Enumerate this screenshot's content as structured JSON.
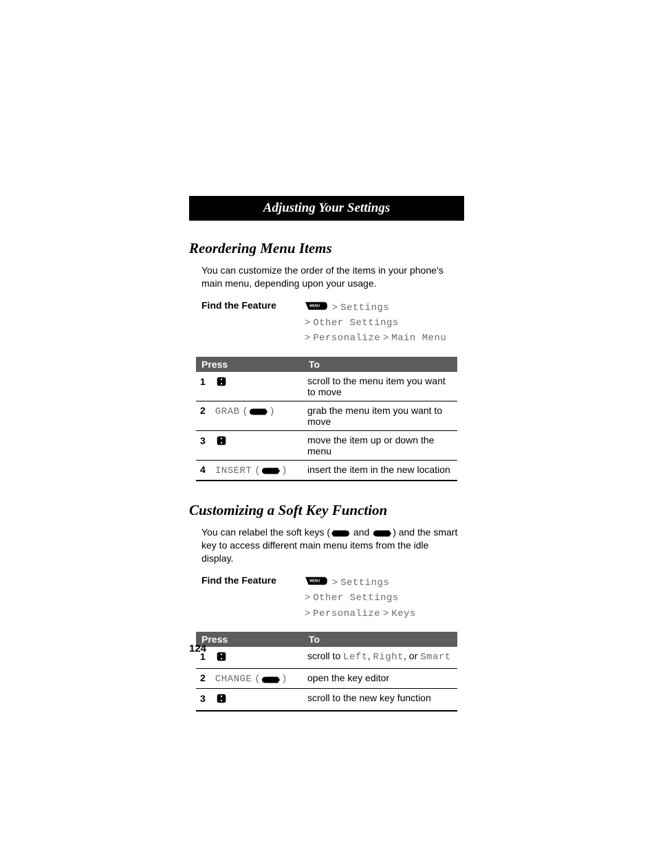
{
  "chapter": "Adjusting Your Settings",
  "section1": {
    "title": "Reordering Menu Items",
    "intro": "You can customize the order of the items in your phone’s main menu, depending upon your usage.",
    "find_feature_label": "Find the Feature",
    "path": {
      "line1_a": "Settings",
      "line2_a": "Other Settings",
      "line3_a": "Personalize",
      "line3_b": "Main Menu"
    },
    "table": {
      "head_press": "Press",
      "head_to": "To",
      "rows": [
        {
          "n": "1",
          "press": "scroll",
          "to": "scroll to the menu item you want to move"
        },
        {
          "n": "2",
          "press": "GRAB",
          "to": "grab the menu item you want to move"
        },
        {
          "n": "3",
          "press": "scroll",
          "to": "move the item up or down the menu"
        },
        {
          "n": "4",
          "press": "INSERT",
          "to": "insert the item in the new location"
        }
      ]
    }
  },
  "section2": {
    "title": "Customizing a Soft Key Function",
    "intro_a": "You can relabel the soft keys (",
    "intro_b": " and ",
    "intro_c": ") and the smart key to access different main menu items from the idle display.",
    "find_feature_label": "Find the Feature",
    "path": {
      "line1_a": "Settings",
      "line2_a": "Other Settings",
      "line3_a": "Personalize",
      "line3_b": "Keys"
    },
    "table": {
      "head_press": "Press",
      "head_to": "To",
      "r1": {
        "n": "1",
        "to_a": "scroll to ",
        "left": "Left",
        "comma": ", ",
        "right": "Right",
        "or": ", or ",
        "smart": "Smart"
      },
      "r2": {
        "n": "2",
        "press": "CHANGE",
        "to": "open the key editor"
      },
      "r3": {
        "n": "3",
        "to": "scroll to the new key function"
      }
    }
  },
  "page_number": "124",
  "menu_label": "MENU"
}
